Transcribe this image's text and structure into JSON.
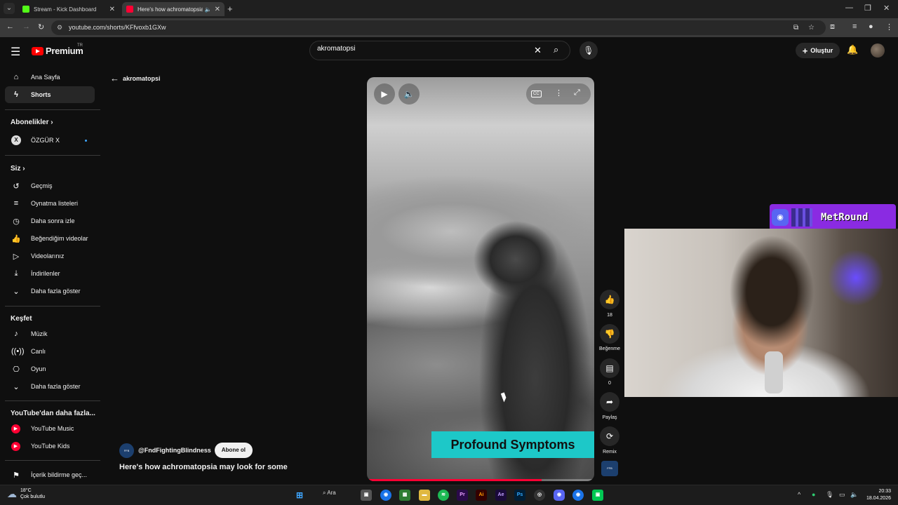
{
  "browser": {
    "tabs": [
      {
        "title": "Stream - Kick Dashboard",
        "fav_color": "#53fc18"
      },
      {
        "title": "Here's how achromatopsia",
        "fav_color": "#ff0033"
      }
    ],
    "url": "youtube.com/shorts/KFfvoxb1GXw"
  },
  "header": {
    "logo_text": "Premium",
    "region": "TR",
    "search_value": "akromatopsi",
    "create_label": "Oluştur"
  },
  "sidebar": {
    "home": "Ana Sayfa",
    "shorts": "Shorts",
    "subscriptions_heading": "Abonelikler",
    "channel_name": "ÖZGÜR X",
    "you_heading": "Siz",
    "history": "Geçmiş",
    "playlists": "Oynatma listeleri",
    "watch_later": "Daha sonra izle",
    "liked": "Beğendiğim videolar",
    "your_videos": "Videolarınız",
    "downloads": "İndirilenler",
    "show_more_1": "Daha fazla göster",
    "explore_heading": "Keşfet",
    "music": "Müzik",
    "live": "Canlı",
    "gaming": "Oyun",
    "show_more_2": "Daha fazla göster",
    "more_heading": "YouTube'dan daha fazla...",
    "yt_music": "YouTube Music",
    "yt_kids": "YouTube Kids",
    "report_history": "İçerik bildirme geç..."
  },
  "main": {
    "back_label": "akromatopsi",
    "caption": "Profound Symptoms",
    "progress": 0.77,
    "channel_handle": "@FndFightingBlindness",
    "subscribe_label": "Abone ol",
    "short_title": "Here's how achromatopsia may look for some"
  },
  "actions": {
    "like_count": "18",
    "dislike_label": "Beğenme",
    "comment_count": "0",
    "share_label": "Paylaş",
    "remix_label": "Remix"
  },
  "overlay": {
    "streamer_name": "MetRound"
  },
  "taskbar": {
    "temperature": "18°C",
    "weather": "Çok bulutlu",
    "search_label": "Ara",
    "time": "20:33",
    "date": "18.04.2026"
  }
}
